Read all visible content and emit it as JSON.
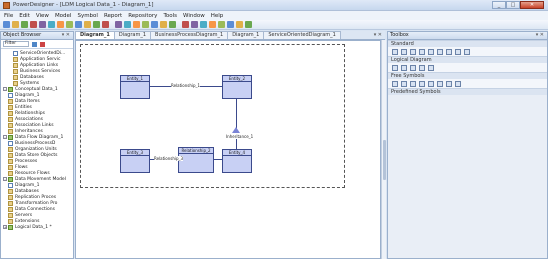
{
  "window": {
    "title": "PowerDesigner - [LDM Logical Data_1 - Diagram_1]",
    "minimize": "_",
    "maximize": "□",
    "close": "✕"
  },
  "menu": [
    "File",
    "Edit",
    "View",
    "Model",
    "Symbol",
    "Report",
    "Repository",
    "Tools",
    "Window",
    "Help"
  ],
  "toolbar_icons": [
    "new-icon",
    "open-icon",
    "save-icon",
    "save-all-icon",
    "print-icon",
    "cut-icon",
    "copy-icon",
    "paste-icon",
    "delete-icon",
    "undo-icon",
    "redo-icon",
    "find-icon",
    "properties-icon",
    "check-model-icon",
    "generate-icon",
    "reverse-icon",
    "compare-icon",
    "merge-icon",
    "impact-icon",
    "zoom-in-icon",
    "zoom-out-icon",
    "zoom-fit-icon",
    "grid-icon",
    "align-icon",
    "layout-icon",
    "refresh-icon",
    "help-icon"
  ],
  "browser": {
    "title": "Object Browser",
    "pin": "▾ ✕",
    "filter": "Filter",
    "items": [
      {
        "label": "ServiceOrientedDi...",
        "indent": 2,
        "icon": "diagram",
        "exp": ""
      },
      {
        "label": "Application Servic",
        "indent": 2,
        "icon": "folder",
        "exp": ""
      },
      {
        "label": "Application Links",
        "indent": 2,
        "icon": "folder",
        "exp": ""
      },
      {
        "label": "Business Services",
        "indent": 2,
        "icon": "folder",
        "exp": ""
      },
      {
        "label": "Databases",
        "indent": 2,
        "icon": "folder",
        "exp": ""
      },
      {
        "label": "Systems",
        "indent": 2,
        "icon": "folder",
        "exp": ""
      },
      {
        "label": "Conceptual Data_1",
        "indent": 0,
        "icon": "model",
        "exp": "-"
      },
      {
        "label": "Diagram_1",
        "indent": 1,
        "icon": "diagram",
        "exp": ""
      },
      {
        "label": "Data Items",
        "indent": 1,
        "icon": "folder",
        "exp": ""
      },
      {
        "label": "Entities",
        "indent": 1,
        "icon": "folder",
        "exp": ""
      },
      {
        "label": "Relationships",
        "indent": 1,
        "icon": "folder",
        "exp": ""
      },
      {
        "label": "Associations",
        "indent": 1,
        "icon": "folder",
        "exp": ""
      },
      {
        "label": "Association Links",
        "indent": 1,
        "icon": "folder",
        "exp": ""
      },
      {
        "label": "Inheritances",
        "indent": 1,
        "icon": "folder",
        "exp": ""
      },
      {
        "label": "Data Flow Diagram_1",
        "indent": 0,
        "icon": "model",
        "exp": "-"
      },
      {
        "label": "BusinessProcessD",
        "indent": 1,
        "icon": "diagram",
        "exp": ""
      },
      {
        "label": "Organization Units",
        "indent": 1,
        "icon": "folder",
        "exp": ""
      },
      {
        "label": "Data Store Objects",
        "indent": 1,
        "icon": "folder",
        "exp": ""
      },
      {
        "label": "Processes",
        "indent": 1,
        "icon": "folder",
        "exp": ""
      },
      {
        "label": "Flows",
        "indent": 1,
        "icon": "folder",
        "exp": ""
      },
      {
        "label": "Resource Flows",
        "indent": 1,
        "icon": "folder",
        "exp": ""
      },
      {
        "label": "Data Movement Model",
        "indent": 0,
        "icon": "model",
        "exp": "-"
      },
      {
        "label": "Diagram_1",
        "indent": 1,
        "icon": "diagram",
        "exp": ""
      },
      {
        "label": "Databases",
        "indent": 1,
        "icon": "folder",
        "exp": ""
      },
      {
        "label": "Replication Proces",
        "indent": 1,
        "icon": "folder",
        "exp": ""
      },
      {
        "label": "Transformation Pro",
        "indent": 1,
        "icon": "folder",
        "exp": ""
      },
      {
        "label": "Data Connections",
        "indent": 1,
        "icon": "folder",
        "exp": ""
      },
      {
        "label": "Servers",
        "indent": 1,
        "icon": "folder",
        "exp": ""
      },
      {
        "label": "Extensions",
        "indent": 1,
        "icon": "folder",
        "exp": ""
      },
      {
        "label": "Logical Data_1 *",
        "indent": 0,
        "icon": "model",
        "exp": "+"
      }
    ]
  },
  "tabs": [
    {
      "label": "Diagram_1",
      "active": true
    },
    {
      "label": "Diagram_1",
      "active": false
    },
    {
      "label": "BusinessProcessDiagram_1",
      "active": false
    },
    {
      "label": "Diagram_1",
      "active": false
    },
    {
      "label": "ServiceOrientedDiagram_1",
      "active": false
    }
  ],
  "tab_close": "▾ ✕",
  "diagram": {
    "entities": [
      "Entity_1",
      "Entity_2",
      "Entity_3",
      "Entity_4"
    ],
    "relationships": [
      "Relationship_1",
      "Relationship_2"
    ],
    "inheritance": "Inheritance_1",
    "association_label": "Relationship_3"
  },
  "toolbox": {
    "title": "Toolbox",
    "pin": "▾ ✕",
    "sections": [
      {
        "label": "Standard",
        "tools": 9
      },
      {
        "label": "Logical Diagram",
        "tools": 5
      },
      {
        "label": "Free Symbols",
        "tools": 8
      },
      {
        "label": "Predefined Symbols",
        "tools": 0
      }
    ]
  }
}
